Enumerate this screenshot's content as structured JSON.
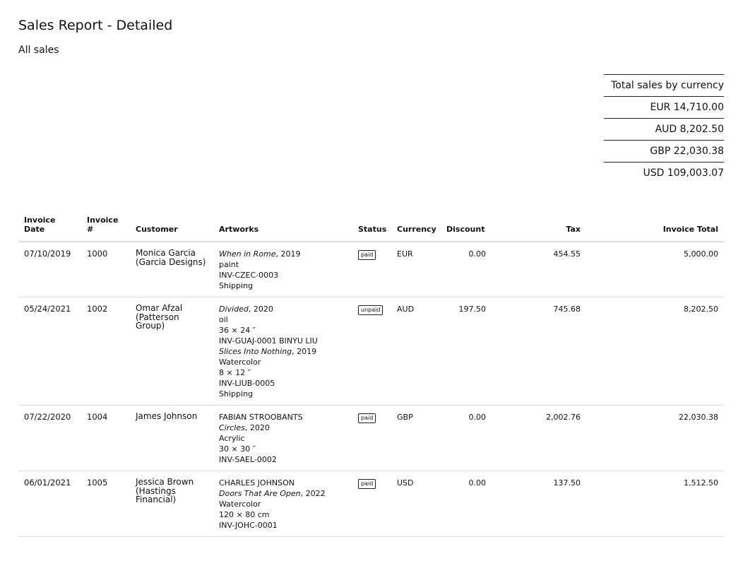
{
  "report": {
    "title": "Sales Report - Detailed",
    "subtitle": "All sales"
  },
  "totals": {
    "heading": "Total sales by currency",
    "rows": [
      "EUR 14,710.00",
      "AUD 8,202.50",
      "GBP 22,030.38",
      "USD 109,003.07"
    ]
  },
  "table": {
    "headers": {
      "invoice_date": "Invoice Date",
      "invoice_no": "Invoice #",
      "customer": "Customer",
      "artworks": "Artworks",
      "status": "Status",
      "currency": "Currency",
      "discount": "Discount",
      "tax": "Tax",
      "invoice_total": "Invoice Total"
    },
    "rows": [
      {
        "date": "07/10/2019",
        "number": "1000",
        "customer": "Monica Garcia (Garcia Designs)",
        "artworks": [
          {
            "title": "When in Rome",
            "rest": ", 2019"
          },
          {
            "text": "paint"
          },
          {
            "text": "INV-CZEC-0003"
          },
          {
            "text": "Shipping"
          }
        ],
        "status": "paid",
        "currency": "EUR",
        "discount": "0.00",
        "tax": "454.55",
        "total": "5,000.00"
      },
      {
        "date": "05/24/2021",
        "number": "1002",
        "customer": "Omar Afzal (Patterson Group)",
        "artworks": [
          {
            "title": "Divided",
            "rest": ", 2020"
          },
          {
            "text": "oil"
          },
          {
            "text": "36 × 24 ″"
          },
          {
            "text": "INV-GUAJ-0001 BINYU LIU"
          },
          {
            "title": "Slices Into Nothing",
            "rest": ", 2019"
          },
          {
            "text": "Watercolor"
          },
          {
            "text": "8 × 12 ″"
          },
          {
            "text": "INV-LIUB-0005"
          },
          {
            "text": "Shipping"
          }
        ],
        "status": "unpaid",
        "currency": "AUD",
        "discount": "197.50",
        "tax": "745.68",
        "total": "8,202.50"
      },
      {
        "date": "07/22/2020",
        "number": "1004",
        "customer": "James Johnson",
        "artworks": [
          {
            "text": "FABIAN STROOBANTS"
          },
          {
            "title": "Circles",
            "rest": ", 2020"
          },
          {
            "text": "Acrylic"
          },
          {
            "text": "30 × 30 ″"
          },
          {
            "text": "INV-SAEL-0002"
          }
        ],
        "status": "paid",
        "currency": "GBP",
        "discount": "0.00",
        "tax": "2,002.76",
        "total": "22,030.38"
      },
      {
        "date": "06/01/2021",
        "number": "1005",
        "customer": "Jessica Brown (Hastings Financial)",
        "artworks": [
          {
            "text": "CHARLES JOHNSON"
          },
          {
            "title": "Doors That Are Open",
            "rest": ", 2022"
          },
          {
            "text": "Watercolor"
          },
          {
            "text": "120 × 80 cm"
          },
          {
            "text": "INV-JOHC-0001"
          }
        ],
        "status": "paid",
        "currency": "USD",
        "discount": "0.00",
        "tax": "137.50",
        "total": "1,512.50"
      }
    ]
  }
}
